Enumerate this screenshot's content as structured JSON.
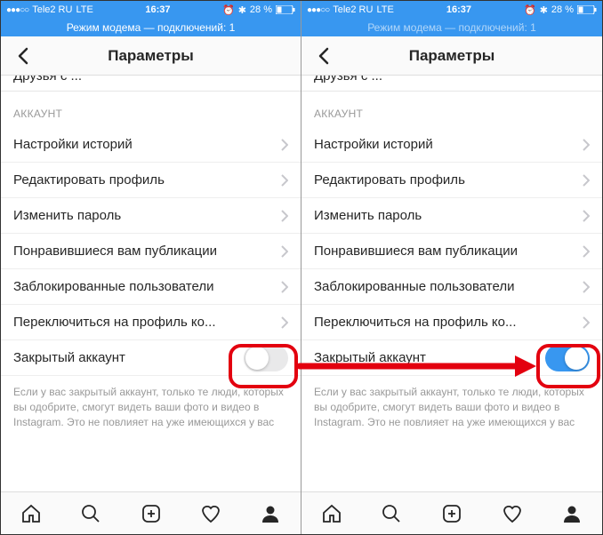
{
  "status": {
    "signal": "●●●○○",
    "carrier": "Tele2 RU",
    "network": "LTE",
    "time": "16:37",
    "bt": "✱",
    "battery_pct": "28 %",
    "battery_icon": "▮"
  },
  "hotspot": "Режим модема — подключений: 1",
  "nav": {
    "title": "Параметры"
  },
  "partial_row": "Друзья с ...",
  "section": "АККАУНТ",
  "rows": {
    "r0": "Настройки историй",
    "r1": "Редактировать профиль",
    "r2": "Изменить пароль",
    "r3": "Понравившиеся вам публикации",
    "r4": "Заблокированные пользователи",
    "r5": "Переключиться на профиль ко...",
    "r6": "Закрытый аккаунт"
  },
  "footer": "Если у вас закрытый аккаунт, только те люди, которых вы одобрите, смогут видеть ваши фото и видео в Instagram. Это не повлияет на уже имеющихся у вас"
}
